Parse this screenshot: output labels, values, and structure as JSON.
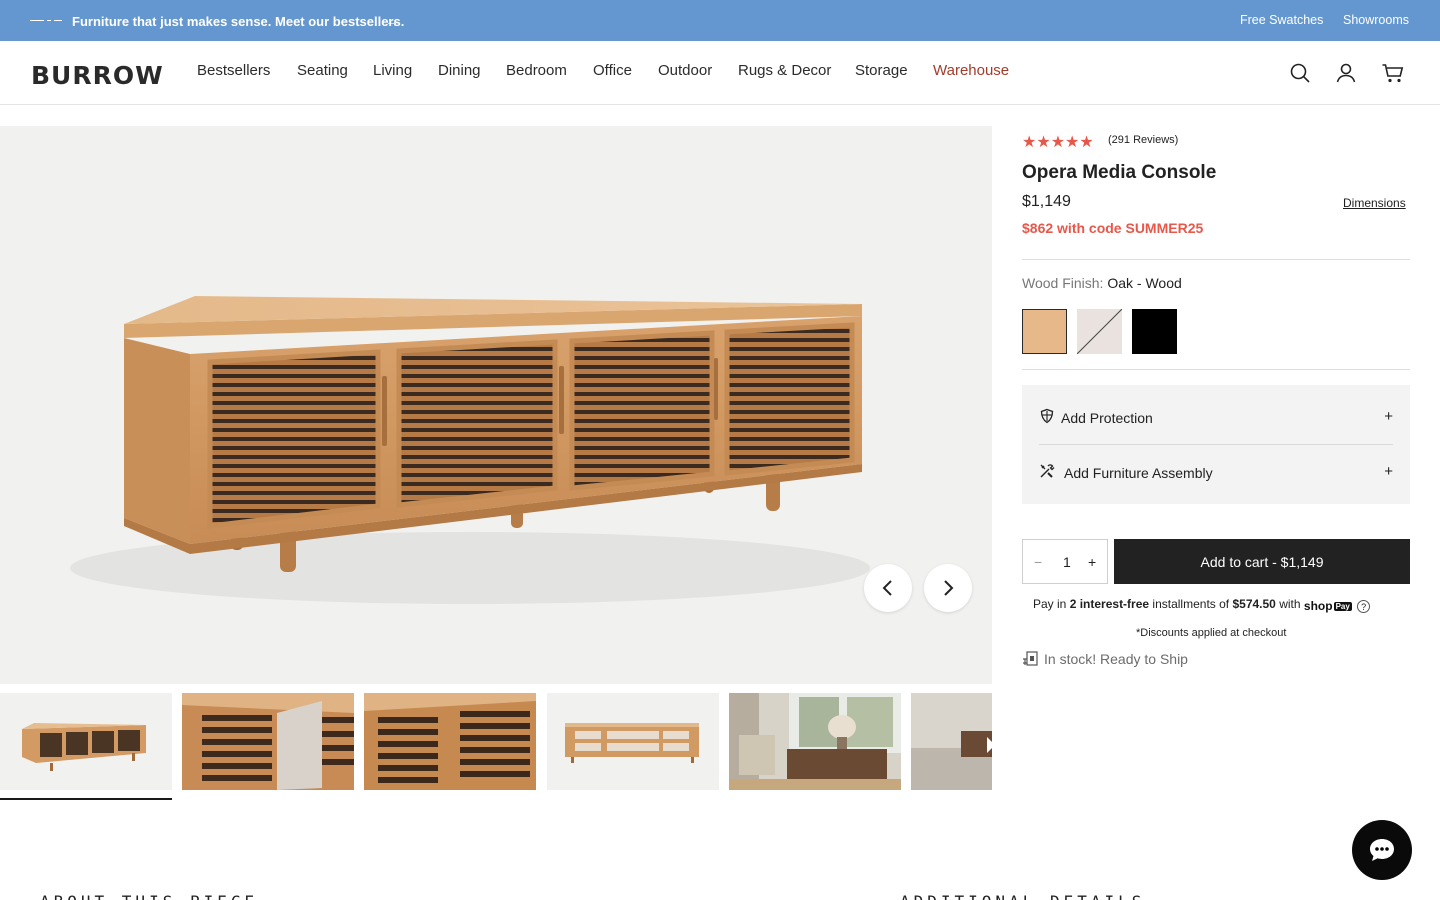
{
  "announcement": {
    "message": "Furniture that just makes sense. Meet our bestsellers.",
    "arrow": "→",
    "links": [
      "Free Swatches",
      "Showrooms"
    ]
  },
  "header": {
    "logo": "BURROW",
    "nav": [
      "Bestsellers",
      "Seating",
      "Living",
      "Dining",
      "Bedroom",
      "Office",
      "Outdoor",
      "Rugs & Decor",
      "Storage",
      "Warehouse"
    ],
    "icons": [
      "search-icon",
      "account-icon",
      "cart-icon"
    ]
  },
  "gallery": {
    "thumbnails_count": 6,
    "active_thumbnail": 1
  },
  "product": {
    "stars": "★★★★★",
    "rating": 4.5,
    "reviews": "(291 Reviews)",
    "title": "Opera Media Console",
    "price": "$1,149",
    "dimensions_link": "Dimensions",
    "promo": "$862 with code SUMMER25",
    "finish_label": "Wood Finish:",
    "finish_value": "Oak - Wood",
    "swatches": [
      {
        "name": "Oak",
        "color": "#e7b98a"
      },
      {
        "name": "White",
        "color": "#e9e2de"
      },
      {
        "name": "Black",
        "color": "#000000"
      }
    ]
  },
  "addons": [
    {
      "label": "Add Protection",
      "icon": "shield-icon",
      "toggle": "+"
    },
    {
      "label": "Add Furniture Assembly",
      "icon": "tools-icon",
      "toggle": "+"
    }
  ],
  "purchase": {
    "qty_minus": "−",
    "qty_value": "1",
    "qty_plus": "+",
    "add_to_cart": "Add to cart - $1,149",
    "pay_prefix": "Pay in",
    "pay_bold": "2 interest-free",
    "pay_middle": "installments of",
    "pay_amount": "$574.50",
    "pay_with": "with",
    "shoppay": "shop",
    "shoppay_badge": "Pay",
    "help": "?",
    "discount_note": "*Discounts applied at checkout",
    "stock": "In stock! Ready to Ship"
  },
  "sections": {
    "about": "ABOUT THIS PIECE",
    "details": "ADDITIONAL DETAILS"
  },
  "colors": {
    "announcement_bg": "#6497cf",
    "accent_red": "#e8584a",
    "warehouse": "#a33b2a",
    "button_dark": "#222222"
  }
}
